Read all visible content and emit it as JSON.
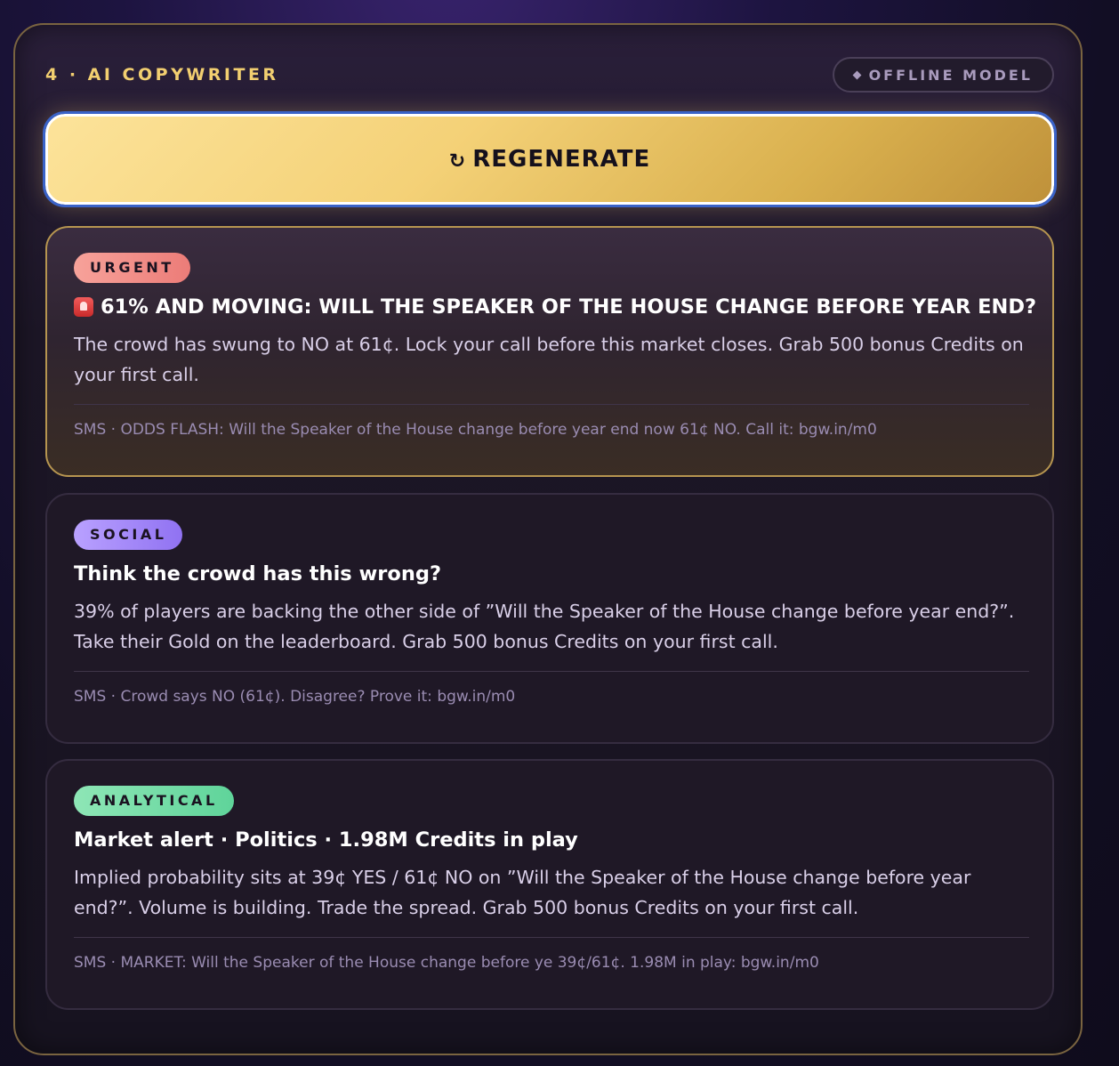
{
  "header": {
    "section_title": "4 · AI COPYWRITER",
    "model_badge": "OFFLINE MODEL",
    "model_badge_icon": "diamond-icon"
  },
  "regenerate": {
    "icon": "refresh-icon",
    "icon_glyph": "↻",
    "label": "REGENERATE"
  },
  "cards": [
    {
      "tag": "URGENT",
      "tag_color": "#ec7c78",
      "headline_icon": "siren-icon",
      "headline": "61% AND MOVING: WILL THE SPEAKER OF THE HOUSE CHANGE BEFORE YEAR END?",
      "body": "The crowd has swung to NO at 61¢. Lock your call before this market closes. Grab 500 bonus Credits on your first call.",
      "sms": "SMS · ODDS FLASH: Will the Speaker of the House change before year end now 61¢ NO. Call it: bgw.in/m0"
    },
    {
      "tag": "SOCIAL",
      "tag_color": "#9072f2",
      "headline": "Think the crowd has this wrong?",
      "body": "39% of players are backing the other side of ”Will the Speaker of the House change before year end?”. Take their Gold on the leaderboard. Grab 500 bonus Credits on your first call.",
      "sms": "SMS · Crowd says NO (61¢). Disagree? Prove it: bgw.in/m0"
    },
    {
      "tag": "ANALYTICAL",
      "tag_color": "#5fd49a",
      "headline": "Market alert · Politics · 1.98M Credits in play",
      "body": "Implied probability sits at 39¢ YES / 61¢ NO on ”Will the Speaker of the House change before year end?”. Volume is building. Trade the spread. Grab 500 bonus Credits on your first call.",
      "sms": "SMS · MARKET: Will the Speaker of the House change before ye 39¢/61¢. 1.98M in play: bgw.in/m0"
    }
  ],
  "colors": {
    "accent_gold": "#f2cf70",
    "panel_border": "#7a6440",
    "focus_ring": "#3a63c8"
  }
}
